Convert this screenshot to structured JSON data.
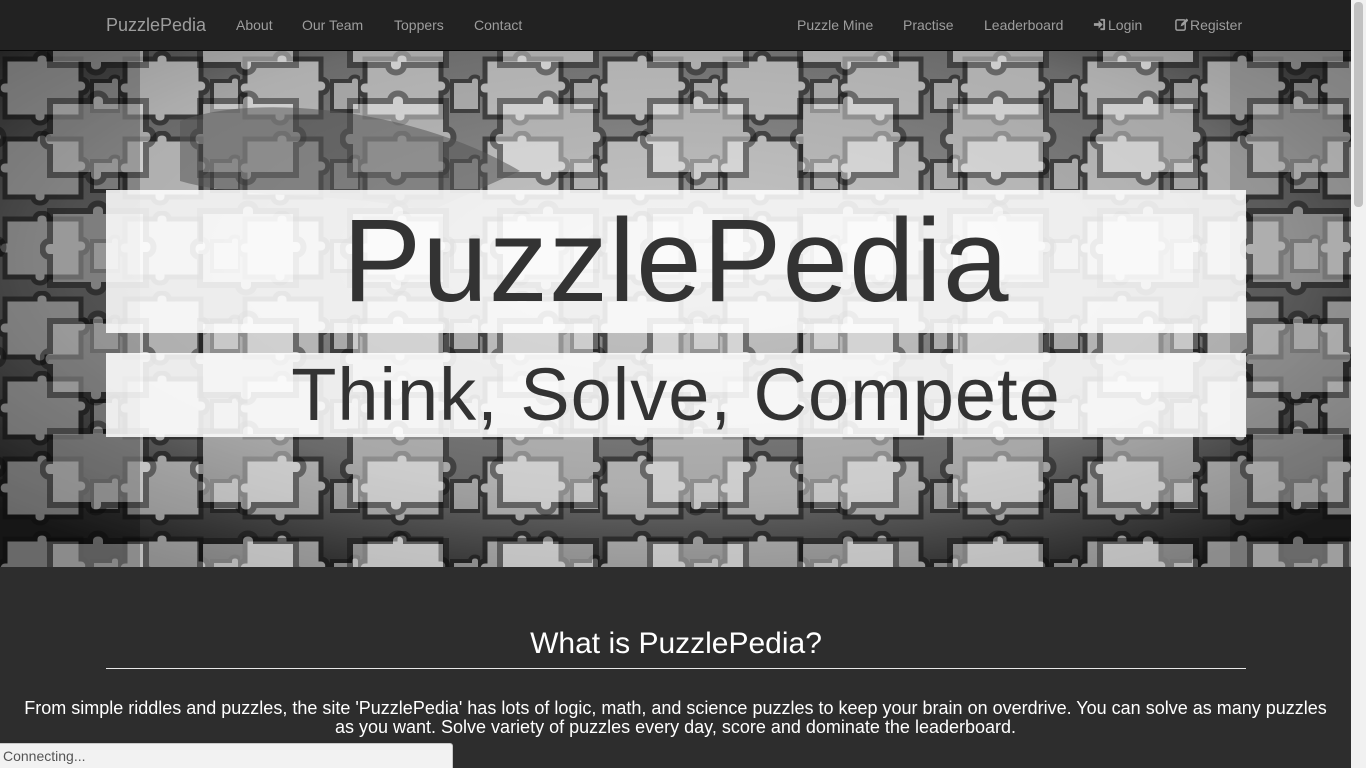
{
  "navbar": {
    "brand": "PuzzlePedia",
    "left_links": [
      "About",
      "Our Team",
      "Toppers",
      "Contact"
    ],
    "right_links": [
      "Puzzle Mine",
      "Practise",
      "Leaderboard"
    ],
    "login": {
      "label": "Login",
      "icon": "log-in-icon"
    },
    "register": {
      "label": "Register",
      "icon": "edit-icon"
    }
  },
  "hero": {
    "title": "PuzzlePedia",
    "subtitle": "Think, Solve, Compete"
  },
  "about": {
    "heading": "What is PuzzlePedia?",
    "text": "From simple riddles and puzzles, the site 'PuzzlePedia' has lots of logic, math, and science puzzles to keep your brain on overdrive. You can solve as many puzzles as you want. Solve variety of puzzles every day, score and dominate the leaderboard."
  },
  "status_bar": {
    "text": "Connecting..."
  },
  "colors": {
    "navbar_bg": "#222222",
    "nav_text": "#9d9d9d",
    "page_bg": "#2d2d2d",
    "hero_text": "#333333"
  }
}
